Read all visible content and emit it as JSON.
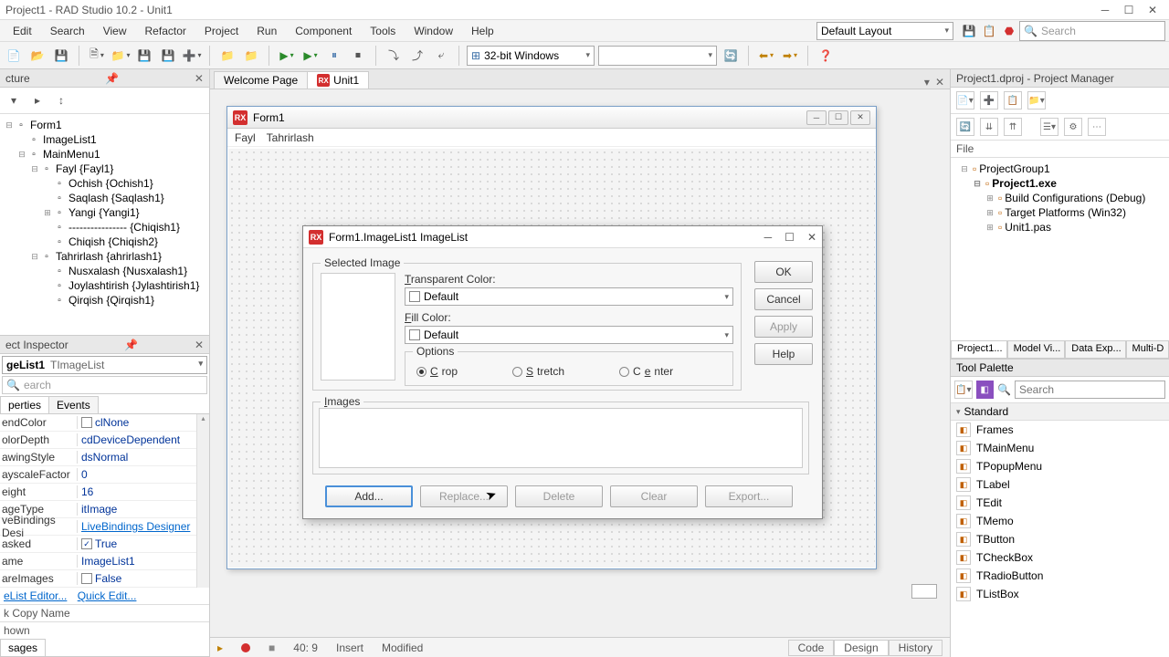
{
  "app": {
    "title": "Project1 - RAD Studio 10.2 - Unit1"
  },
  "menu": [
    "Edit",
    "Search",
    "View",
    "Refactor",
    "Project",
    "Run",
    "Component",
    "Tools",
    "Window",
    "Help"
  ],
  "layout_combo": "Default Layout",
  "top_search_placeholder": "Search",
  "platform_combo": "32-bit Windows",
  "structure": {
    "title": "cture",
    "root": "Form1",
    "items": [
      {
        "depth": 0,
        "exp": "⊟",
        "label": "Form1"
      },
      {
        "depth": 1,
        "exp": "",
        "label": "ImageList1"
      },
      {
        "depth": 1,
        "exp": "⊟",
        "label": "MainMenu1"
      },
      {
        "depth": 2,
        "exp": "⊟",
        "label": "Fayl {Fayl1}"
      },
      {
        "depth": 3,
        "exp": "",
        "label": "Ochish {Ochish1}"
      },
      {
        "depth": 3,
        "exp": "",
        "label": "Saqlash {Saqlash1}"
      },
      {
        "depth": 3,
        "exp": "⊞",
        "label": "Yangi {Yangi1}"
      },
      {
        "depth": 3,
        "exp": "",
        "label": "---------------- {Chiqish1}"
      },
      {
        "depth": 3,
        "exp": "",
        "label": "Chiqish {Chiqish2}"
      },
      {
        "depth": 2,
        "exp": "⊟",
        "label": "Tahrirlash {ahrirlash1}"
      },
      {
        "depth": 3,
        "exp": "",
        "label": "Nusxalash {Nusxalash1}"
      },
      {
        "depth": 3,
        "exp": "",
        "label": "Joylashtirish {Jylashtirish1}"
      },
      {
        "depth": 3,
        "exp": "",
        "label": "Qirqish {Qirqish1}"
      }
    ]
  },
  "inspector": {
    "title": "ect Inspector",
    "obj_name": "geList1",
    "obj_type": "TImageList",
    "search_placeholder": "earch",
    "tabs": [
      "perties",
      "Events"
    ],
    "props": [
      {
        "name": "endColor",
        "val": "clNone",
        "swatch": true
      },
      {
        "name": "olorDepth",
        "val": "cdDeviceDependent"
      },
      {
        "name": "awingStyle",
        "val": "dsNormal"
      },
      {
        "name": "ayscaleFactor",
        "val": "0"
      },
      {
        "name": "eight",
        "val": "16"
      },
      {
        "name": "ageType",
        "val": "itImage"
      },
      {
        "name": "veBindings Desi",
        "val": "LiveBindings Designer",
        "link": true
      },
      {
        "name": "asked",
        "val": "True",
        "check": true
      },
      {
        "name": "ame",
        "val": "ImageList1"
      },
      {
        "name": "areImages",
        "val": "False",
        "check": false
      }
    ],
    "links": [
      "eList Editor...",
      "Quick Edit..."
    ],
    "copy_name": "k Copy Name",
    "shown": "hown",
    "bottom_tab": "sages"
  },
  "doc_tabs": [
    {
      "label": "Welcome Page",
      "active": false,
      "icon": false
    },
    {
      "label": "Unit1",
      "active": true,
      "icon": true
    }
  ],
  "form_designer": {
    "title": "Form1",
    "menus": [
      "Fayl",
      "Tahrirlash"
    ]
  },
  "dialog": {
    "title": "Form1.ImageList1 ImageList",
    "selected_image": "Selected Image",
    "transparent_label": "Transparent Color:",
    "transparent_value": "Default",
    "fill_label": "Fill Color:",
    "fill_value": "Default",
    "options_label": "Options",
    "radios": [
      "Crop",
      "Stretch",
      "Center"
    ],
    "radio_checked": 0,
    "side_buttons": [
      "OK",
      "Cancel",
      "Apply",
      "Help"
    ],
    "side_disabled": [
      false,
      false,
      true,
      false
    ],
    "images_label": "Images",
    "img_buttons": [
      "Add...",
      "Replace...",
      "Delete",
      "Clear",
      "Export..."
    ],
    "img_disabled": [
      false,
      true,
      true,
      true,
      true
    ],
    "img_focused": 0
  },
  "bottom_status": {
    "pos": "40:  9",
    "mode": "Insert",
    "modified": "Modified",
    "view_tabs": [
      "Code",
      "Design",
      "History"
    ],
    "active_view": 1
  },
  "project_mgr": {
    "title": "Project1.dproj - Project Manager",
    "file_label": "File",
    "tree": [
      {
        "depth": 0,
        "exp": "⊟",
        "label": "ProjectGroup1"
      },
      {
        "depth": 1,
        "exp": "⊟",
        "label": "Project1.exe",
        "bold": true
      },
      {
        "depth": 2,
        "exp": "⊞",
        "label": "Build Configurations (Debug)"
      },
      {
        "depth": 2,
        "exp": "⊞",
        "label": "Target Platforms (Win32)"
      },
      {
        "depth": 2,
        "exp": "⊞",
        "label": "Unit1.pas"
      }
    ],
    "tabs": [
      "Project1...",
      "Model Vi...",
      "Data Exp...",
      "Multi-D"
    ]
  },
  "palette": {
    "title": "Tool Palette",
    "search_placeholder": "Search",
    "category": "Standard",
    "items": [
      "Frames",
      "TMainMenu",
      "TPopupMenu",
      "TLabel",
      "TEdit",
      "TMemo",
      "TButton",
      "TCheckBox",
      "TRadioButton",
      "TListBox"
    ]
  }
}
